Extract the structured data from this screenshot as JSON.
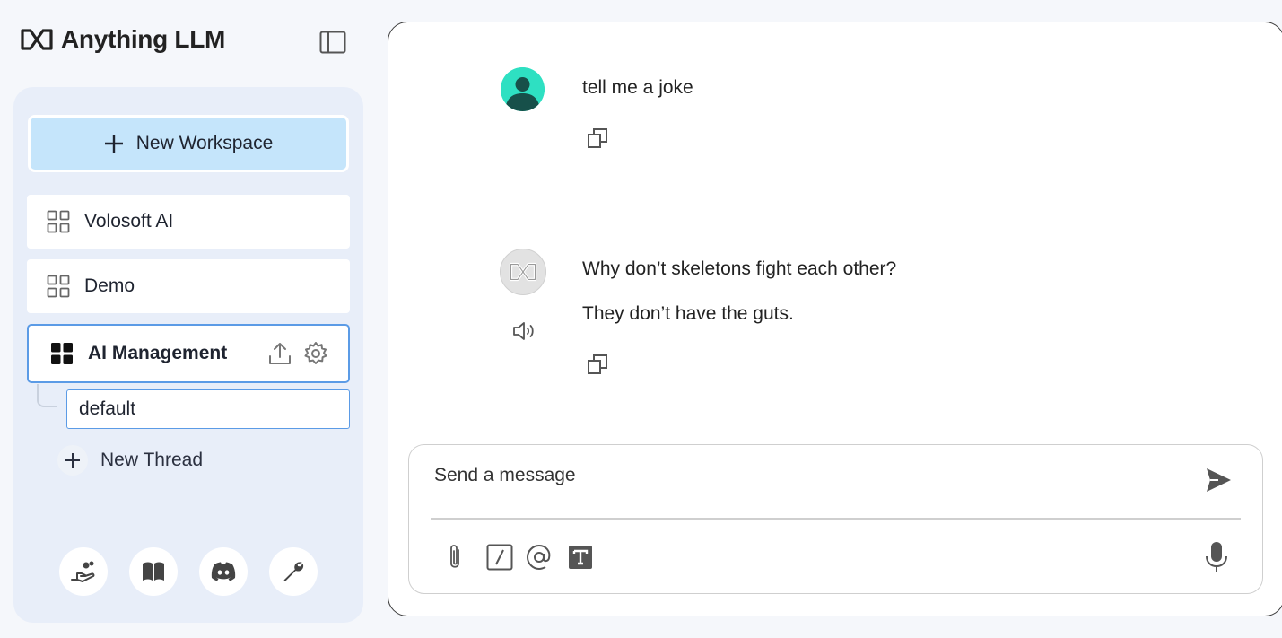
{
  "app": {
    "brand": "Anything LLM"
  },
  "sidebar": {
    "new_workspace_label": "New Workspace",
    "workspaces": [
      {
        "label": "Volosoft AI"
      },
      {
        "label": "Demo"
      },
      {
        "label": "AI Management",
        "active": true
      }
    ],
    "threads": [
      {
        "label": "default",
        "active": true
      }
    ],
    "new_thread_label": "New Thread",
    "footer_icons": [
      "support-hand-icon",
      "book-icon",
      "discord-icon",
      "wrench-icon"
    ]
  },
  "chat": {
    "messages": [
      {
        "role": "user",
        "lines": [
          "tell me a joke"
        ]
      },
      {
        "role": "assistant",
        "lines": [
          "Why don’t skeletons fight each other?",
          "They don’t have the guts."
        ]
      }
    ],
    "composer": {
      "placeholder": "Send a message"
    },
    "toolbar_icons": [
      "paperclip-icon",
      "slash-command-icon",
      "at-mention-icon",
      "text-size-icon",
      "microphone-icon",
      "send-icon"
    ]
  },
  "colors": {
    "new_workspace_bg": "#c5e5fb",
    "sidebar_bg": "#e8eef9",
    "active_border": "#5b9be6",
    "user_avatar": "#2ee0c2"
  }
}
